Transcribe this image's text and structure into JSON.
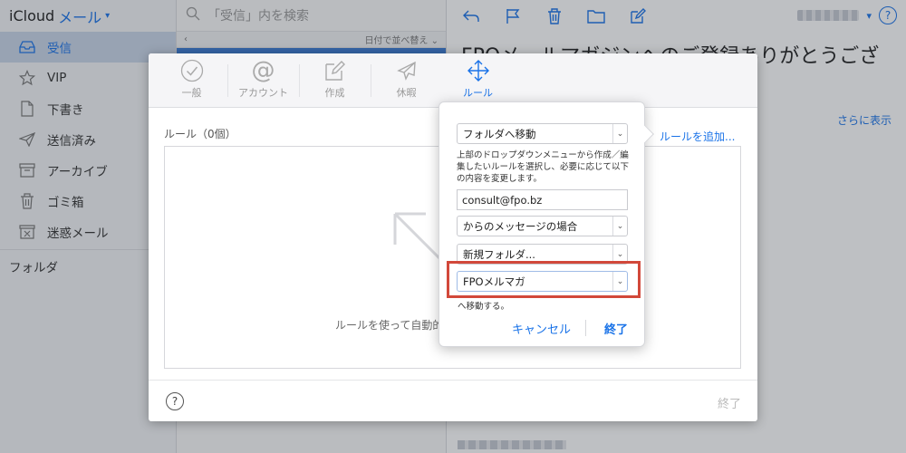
{
  "colors": {
    "accent": "#1a73e8",
    "highlight": "#d2483a",
    "selected_row": "#3a7bd5"
  },
  "sidebar": {
    "brand": "iCloud",
    "app": "メール",
    "items": [
      {
        "label": "受信",
        "icon": "inbox-icon",
        "active": true
      },
      {
        "label": "VIP",
        "icon": "star-icon"
      },
      {
        "label": "下書き",
        "icon": "draft-document-icon"
      },
      {
        "label": "送信済み",
        "icon": "paper-plane-icon"
      },
      {
        "label": "アーカイブ",
        "icon": "archive-box-icon"
      },
      {
        "label": "ゴミ箱",
        "icon": "trash-icon"
      },
      {
        "label": "迷惑メール",
        "icon": "junk-icon"
      }
    ],
    "folders_label": "フォルダ"
  },
  "message_list": {
    "search_placeholder": "「受信」内を検索",
    "sort_label": "日付で並べ替え"
  },
  "reader": {
    "subject": "FPOメールマガジンへのご登録ありがとうござ",
    "more_link": "さらに表示"
  },
  "preferences": {
    "tabs": [
      {
        "label": "一般",
        "icon": "checkmark-circle-icon"
      },
      {
        "label": "アカウント",
        "icon": "at-sign-icon"
      },
      {
        "label": "作成",
        "icon": "compose-icon"
      },
      {
        "label": "休暇",
        "icon": "airplane-icon"
      },
      {
        "label": "ルール",
        "icon": "rules-arrows-icon",
        "active": true
      }
    ],
    "rules_heading": "ルール（0個）",
    "add_rule_link": "ルールを追加...",
    "rules_hint": "ルールを使って自動的",
    "help_label": "?",
    "done_label": "終了"
  },
  "rule_editor": {
    "action_select": "フォルダへ移動",
    "description": "上部のドロップダウンメニューから作成／編集したいルールを選択し、必要に応じて以下の内容を変更します。",
    "sender_input": "consult@fpo.bz",
    "condition_select": "からのメッセージの場合",
    "new_folder_select": "新規フォルダ...",
    "target_folder_select": "FPOメルマガ",
    "move_suffix": "へ移動する。",
    "cancel_label": "キャンセル",
    "done_label": "終了"
  }
}
